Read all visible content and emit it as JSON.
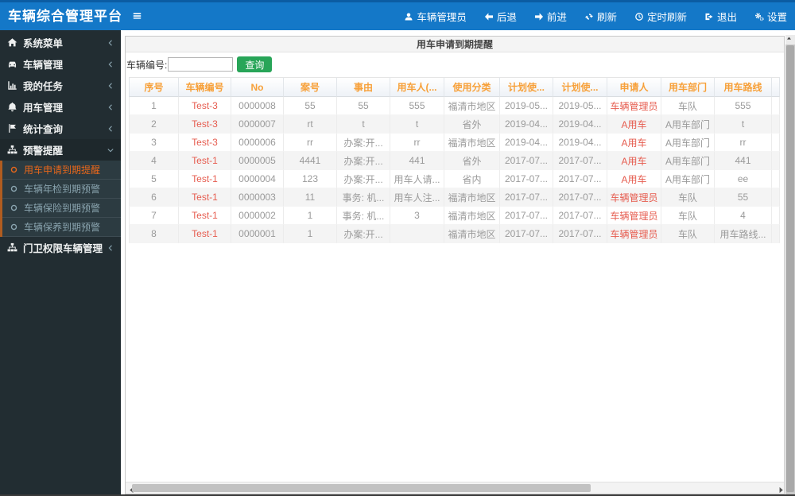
{
  "colors": {
    "header_bg": "#1478c8",
    "sidebar_bg": "#222d32",
    "submenu_bg": "#2c3b41",
    "submenu_accent_border": "#b05c20",
    "table_header_text": "#f7a039",
    "highlight_red_text": "#e65c4f",
    "active_menu_text": "#e8671b",
    "query_button_green": "#28a558"
  },
  "header": {
    "title": "车辆综合管理平台",
    "user": {
      "name": "user-menu",
      "icon": "user",
      "label": "车辆管理员"
    },
    "nav": [
      {
        "name": "back",
        "icon": "arrow-left",
        "label": "后退"
      },
      {
        "name": "forward",
        "icon": "arrow-right",
        "label": "前进"
      },
      {
        "name": "refresh",
        "icon": "refresh",
        "label": "刷新"
      },
      {
        "name": "timed-refresh",
        "icon": "clock",
        "label": "定时刷新"
      },
      {
        "name": "logout",
        "icon": "sign-out",
        "label": "退出"
      },
      {
        "name": "settings",
        "icon": "gears",
        "label": "设置"
      }
    ]
  },
  "sidebar": {
    "items": [
      {
        "type": "item",
        "name": "system-menu",
        "icon": "home",
        "label": "系统菜单",
        "chevron": "left"
      },
      {
        "type": "item",
        "name": "vehicle-management",
        "icon": "car",
        "label": "车辆管理",
        "chevron": "left"
      },
      {
        "type": "item",
        "name": "my-tasks",
        "icon": "chart",
        "label": "我的任务",
        "chevron": "left"
      },
      {
        "type": "item",
        "name": "vehicle-use-mgmt",
        "icon": "bell",
        "label": "用车管理",
        "chevron": "left"
      },
      {
        "type": "item",
        "name": "stats-query",
        "icon": "flag",
        "label": "统计查询",
        "chevron": "left"
      },
      {
        "type": "item",
        "name": "alert-reminder",
        "icon": "sitemap",
        "label": "预警提醒",
        "chevron": "down",
        "expanded": true
      },
      {
        "type": "submenu",
        "items": [
          {
            "name": "use-apply-due-reminder",
            "label": "用车申请到期提醒",
            "active": true
          },
          {
            "name": "annual-inspection-due",
            "label": "车辆年检到期预警",
            "active": false
          },
          {
            "name": "insurance-due",
            "label": "车辆保险到期预警",
            "active": false
          },
          {
            "name": "maintenance-due",
            "label": "车辆保养到期预警",
            "active": false
          }
        ]
      },
      {
        "type": "item",
        "name": "gate-permission-vehicle-mgmt",
        "icon": "sitemap",
        "label": "门卫权限车辆管理",
        "chevron": "left"
      }
    ]
  },
  "main": {
    "page_title": "用车申请到期提醒",
    "search": {
      "label": "车辆编号:",
      "value": "",
      "button_label": "查询"
    },
    "table": {
      "columns": [
        "序号",
        "车辆编号",
        "No",
        "案号",
        "事由",
        "用车人(...",
        "使用分类",
        "计划使...",
        "计划使...",
        "申请人",
        "用车部门",
        "用车路线"
      ],
      "red_columns": [
        1,
        9
      ],
      "rows": [
        [
          "1",
          "Test-3",
          "0000008",
          "55",
          "55",
          "555",
          "福清市地区",
          "2019-05...",
          "2019-05...",
          "车辆管理员",
          "车队",
          "555"
        ],
        [
          "2",
          "Test-3",
          "0000007",
          "rt",
          "t",
          "t",
          "省外",
          "2019-04...",
          "2019-04...",
          "A用车",
          "A用车部门",
          "t"
        ],
        [
          "3",
          "Test-3",
          "0000006",
          "rr",
          "办案:开...",
          "rr",
          "福清市地区",
          "2019-04...",
          "2019-04...",
          "A用车",
          "A用车部门",
          "rr"
        ],
        [
          "4",
          "Test-1",
          "0000005",
          "4441",
          "办案:开...",
          "441",
          "省外",
          "2017-07...",
          "2017-07...",
          "A用车",
          "A用车部门",
          "441"
        ],
        [
          "5",
          "Test-1",
          "0000004",
          "123",
          "办案:开...",
          "用车人请...",
          "省内",
          "2017-07...",
          "2017-07...",
          "A用车",
          "A用车部门",
          "ee"
        ],
        [
          "6",
          "Test-1",
          "0000003",
          "11",
          "事务: 机...",
          "用车人注...",
          "福清市地区",
          "2017-07...",
          "2017-07...",
          "车辆管理员",
          "车队",
          "55"
        ],
        [
          "7",
          "Test-1",
          "0000002",
          "1",
          "事务: 机...",
          "3",
          "福清市地区",
          "2017-07...",
          "2017-07...",
          "车辆管理员",
          "车队",
          "4"
        ],
        [
          "8",
          "Test-1",
          "0000001",
          "1",
          "办案:开...",
          "",
          "福清市地区",
          "2017-07...",
          "2017-07...",
          "车辆管理员",
          "车队",
          "用车路线..."
        ]
      ]
    }
  }
}
